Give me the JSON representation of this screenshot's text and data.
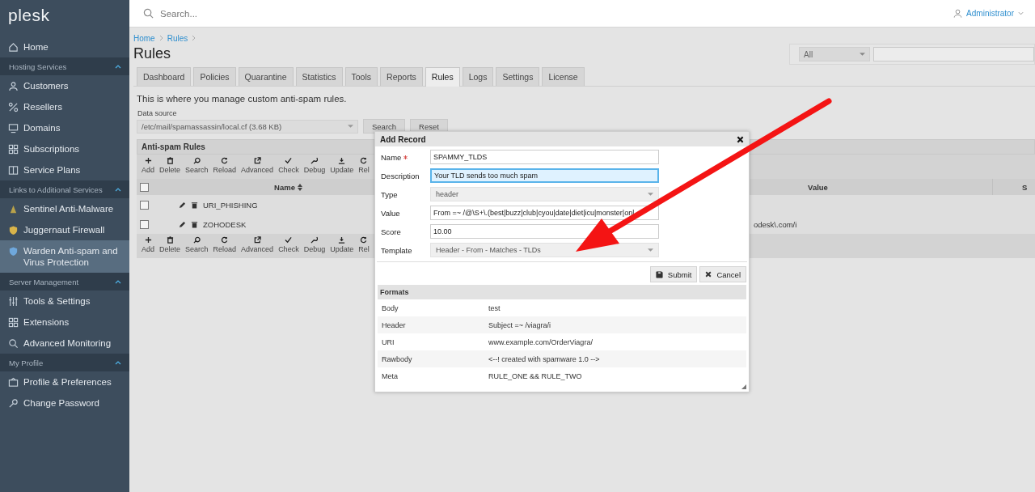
{
  "sidebar": {
    "logo": "plesk",
    "items": [
      {
        "kind": "item",
        "label": "Home",
        "selected": false
      },
      {
        "kind": "section",
        "label": "Hosting Services",
        "expanded": true
      },
      {
        "kind": "item",
        "label": "Customers",
        "selected": false
      },
      {
        "kind": "item",
        "label": "Resellers",
        "selected": false
      },
      {
        "kind": "item",
        "label": "Domains",
        "selected": false
      },
      {
        "kind": "item",
        "label": "Subscriptions",
        "selected": false
      },
      {
        "kind": "item",
        "label": "Service Plans",
        "selected": false
      },
      {
        "kind": "section",
        "label": "Links to Additional Services",
        "expanded": true
      },
      {
        "kind": "item",
        "label": "Sentinel Anti-Malware",
        "selected": false
      },
      {
        "kind": "item",
        "label": "Juggernaut Firewall",
        "selected": false
      },
      {
        "kind": "item",
        "label": "Warden Anti-spam and Virus Protection",
        "selected": true
      },
      {
        "kind": "section",
        "label": "Server Management",
        "expanded": true
      },
      {
        "kind": "item",
        "label": "Tools & Settings",
        "selected": false
      },
      {
        "kind": "item",
        "label": "Extensions",
        "selected": false
      },
      {
        "kind": "item",
        "label": "Advanced Monitoring",
        "selected": false
      },
      {
        "kind": "section",
        "label": "My Profile",
        "expanded": true
      },
      {
        "kind": "item",
        "label": "Profile & Preferences",
        "selected": false
      },
      {
        "kind": "item",
        "label": "Change Password",
        "selected": false
      }
    ]
  },
  "topbar": {
    "search": {
      "placeholder": "Search..."
    },
    "user": "Administrator"
  },
  "breadcrumbs": [
    "Home",
    "Rules"
  ],
  "title": "Rules",
  "filter": {
    "select": "All"
  },
  "tabs": [
    {
      "label": "Dashboard",
      "selected": false
    },
    {
      "label": "Policies",
      "selected": false
    },
    {
      "label": "Quarantine",
      "selected": false
    },
    {
      "label": "Statistics",
      "selected": false
    },
    {
      "label": "Tools",
      "selected": false
    },
    {
      "label": "Reports",
      "selected": false
    },
    {
      "label": "Rules",
      "selected": true
    },
    {
      "label": "Logs",
      "selected": false
    },
    {
      "label": "Settings",
      "selected": false
    },
    {
      "label": "License",
      "selected": false
    }
  ],
  "intro": "This is where you manage custom anti-spam rules.",
  "data_source": {
    "label": "Data source",
    "value": "/etc/mail/spamassassin/local.cf (3.68 KB)",
    "buttons": [
      "Search",
      "Reset"
    ]
  },
  "rules_panel": {
    "title": "Anti-spam Rules",
    "toolbar": [
      "Add",
      "Delete",
      "Search",
      "Reload",
      "Advanced",
      "Check",
      "Debug",
      "Update",
      "Rel"
    ],
    "columns": [
      "Name",
      "Value",
      "S"
    ],
    "select_all_checked": false,
    "rows": [
      {
        "name": "URI_PHISHING",
        "checked": false
      },
      {
        "name": "ZOHODESK",
        "value": "odesk\\.com/i",
        "checked": false
      }
    ],
    "bottom_toolbar": [
      "Add",
      "Delete",
      "Search",
      "Reload",
      "Advanced",
      "Check",
      "Debug",
      "Update",
      "Rel"
    ]
  },
  "dialog": {
    "title": "Add Record",
    "fields": [
      {
        "label": "Name",
        "kind": "text",
        "value": "SPAMMY_TLDS",
        "required": true,
        "focused": false
      },
      {
        "label": "Description",
        "kind": "text",
        "value": "Your TLD sends too much spam",
        "required": false,
        "focused": true
      },
      {
        "label": "Type",
        "kind": "select",
        "value": "header",
        "required": false,
        "focused": false
      },
      {
        "label": "Value",
        "kind": "text",
        "value": "From =~ /@\\S+\\.(best|buzz|club|cyou|date|diet|icu|monster|onl",
        "required": false,
        "focused": false
      },
      {
        "label": "Score",
        "kind": "text",
        "value": "10.00",
        "required": false,
        "focused": false
      },
      {
        "label": "Template",
        "kind": "select",
        "value": "Header - From - Matches - TLDs",
        "required": false,
        "focused": false
      }
    ],
    "buttons": [
      "Submit",
      "Cancel"
    ],
    "formats": {
      "title": "Formats",
      "rows": [
        {
          "type": "Body",
          "example": "test"
        },
        {
          "type": "Header",
          "example": "Subject =~ /viagra/i"
        },
        {
          "type": "URI",
          "example": "www.example.com/OrderViagra/"
        },
        {
          "type": "Rawbody",
          "example": "<--! created with spamware 1.0 -->"
        },
        {
          "type": "Meta",
          "example": "RULE_ONE && RULE_TWO"
        }
      ]
    }
  }
}
